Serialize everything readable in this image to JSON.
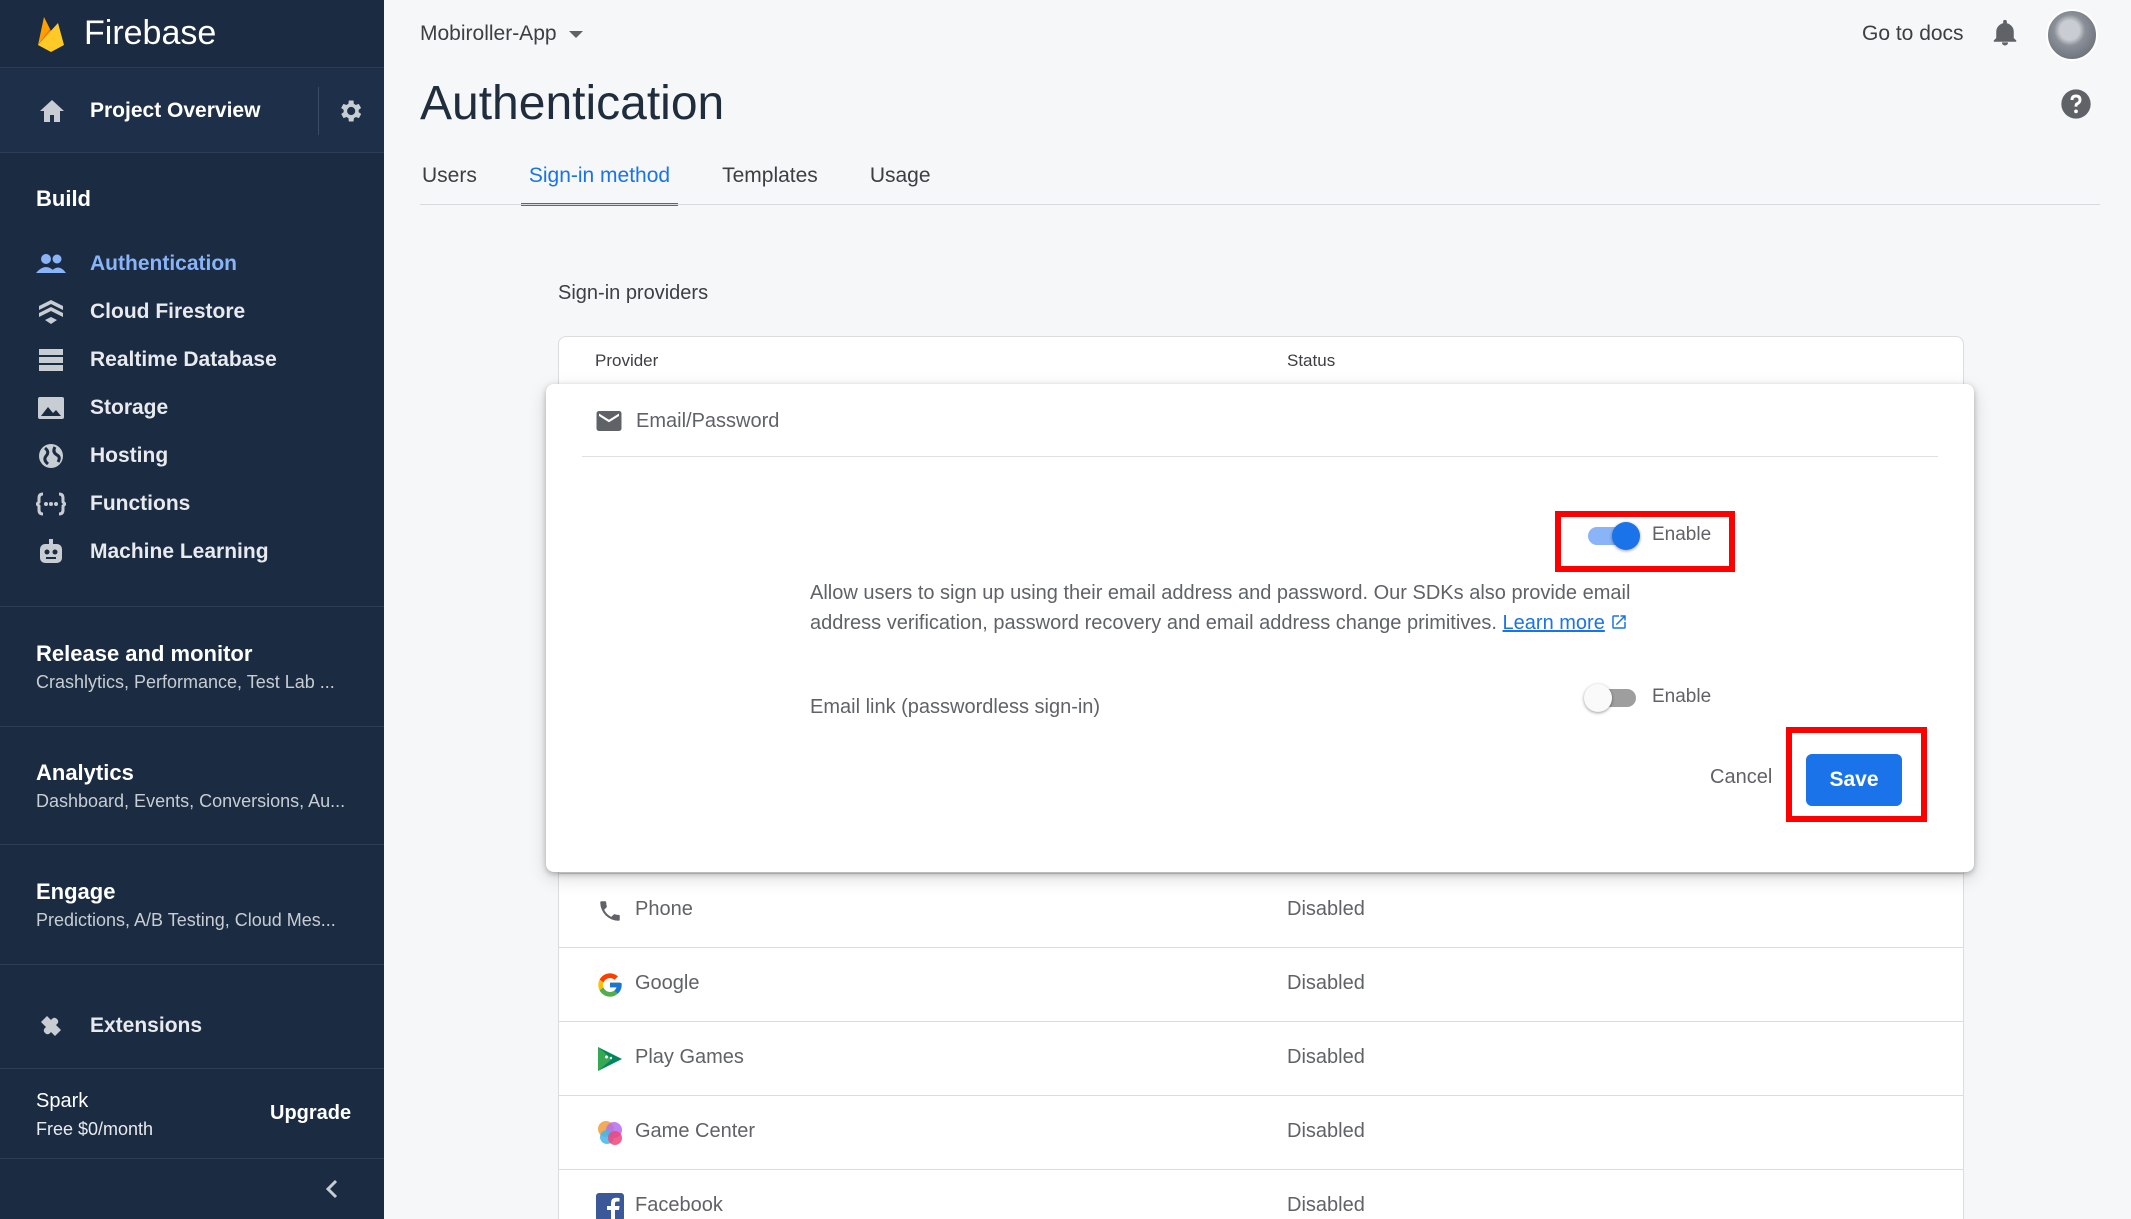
{
  "brand": {
    "name": "Firebase"
  },
  "sidebar": {
    "overview": "Project Overview",
    "build_heading": "Build",
    "build_items": [
      {
        "label": "Authentication",
        "icon": "people-icon",
        "active": true
      },
      {
        "label": "Cloud Firestore",
        "icon": "firestore-icon"
      },
      {
        "label": "Realtime Database",
        "icon": "database-icon"
      },
      {
        "label": "Storage",
        "icon": "image-icon"
      },
      {
        "label": "Hosting",
        "icon": "globe-icon"
      },
      {
        "label": "Functions",
        "icon": "functions-icon"
      },
      {
        "label": "Machine Learning",
        "icon": "robot-icon"
      }
    ],
    "sections": [
      {
        "title": "Release and monitor",
        "sub": "Crashlytics, Performance, Test Lab ..."
      },
      {
        "title": "Analytics",
        "sub": "Dashboard, Events, Conversions, Au..."
      },
      {
        "title": "Engage",
        "sub": "Predictions, A/B Testing, Cloud Mes..."
      }
    ],
    "extensions": "Extensions",
    "plan": {
      "name": "Spark",
      "price": "Free $0/month",
      "upgrade": "Upgrade"
    }
  },
  "header": {
    "project": "Mobiroller-App",
    "docs": "Go to docs",
    "title": "Authentication"
  },
  "tabs": [
    "Users",
    "Sign-in method",
    "Templates",
    "Usage"
  ],
  "active_tab": "Sign-in method",
  "providers": {
    "section_title": "Sign-in providers",
    "col_provider": "Provider",
    "col_status": "Status",
    "expanded": {
      "name": "Email/Password",
      "enable_label": "Enable",
      "enabled": true,
      "description": "Allow users to sign up using their email address and password. Our SDKs also provide email address verification, password recovery and email address change primitives.",
      "learn_more": "Learn more",
      "email_link_label": "Email link (passwordless sign-in)",
      "email_link_enable_label": "Enable",
      "email_link_enabled": false,
      "cancel": "Cancel",
      "save": "Save"
    },
    "rows": [
      {
        "name": "Phone",
        "status": "Disabled",
        "icon": "phone-icon"
      },
      {
        "name": "Google",
        "status": "Disabled",
        "icon": "google-icon"
      },
      {
        "name": "Play Games",
        "status": "Disabled",
        "icon": "play-games-icon"
      },
      {
        "name": "Game Center",
        "status": "Disabled",
        "icon": "game-center-icon"
      },
      {
        "name": "Facebook",
        "status": "Disabled",
        "icon": "facebook-icon"
      }
    ]
  },
  "colors": {
    "accent": "#1a73e8",
    "sidebar_bg": "#1a2b42",
    "highlight": "#ff0000"
  }
}
